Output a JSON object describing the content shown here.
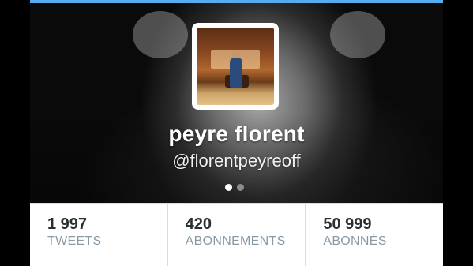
{
  "profile": {
    "name": "peyre florent",
    "handle": "@florentpeyreoff"
  },
  "carousel": {
    "page_count": 2,
    "active_index": 0
  },
  "stats": [
    {
      "value": "1 997",
      "label": "TWEETS"
    },
    {
      "value": "420",
      "label": "ABONNEMENTS"
    },
    {
      "value": "50 999",
      "label": "ABONNÉS"
    }
  ],
  "colors": {
    "accent": "#55acee",
    "stat_label": "#8899a6",
    "stat_value": "#292f33"
  }
}
